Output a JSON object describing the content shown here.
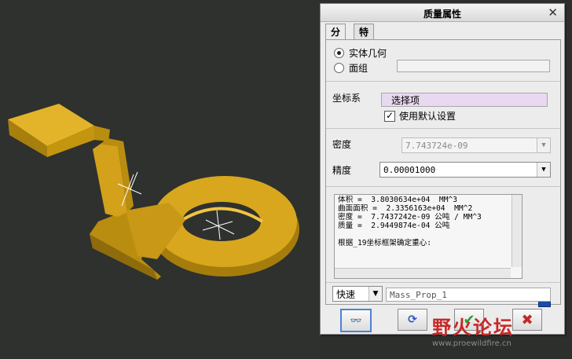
{
  "dialog": {
    "title": "质量属性",
    "tabs": [
      "分析",
      "特征"
    ],
    "radio_options": [
      "实体几何",
      "面组"
    ],
    "selected_option": "实体几何",
    "coordinate_system_label": "坐标系",
    "select_item": "选择项",
    "use_default_setting": "使用默认设置",
    "use_default_checked": true,
    "density_label": "密度",
    "density_value": "7.743724e-09",
    "precision_label": "精度",
    "precision_value": "0.00001000",
    "results_lines": [
      "体积 =  3.8030634e+04  MM^3",
      "曲面面积 =  2.3356163e+04  MM^2",
      "密度 =  7.7437242e-09 公吨 / MM^3",
      "质量 =  2.9449874e-04 公吨",
      "",
      "根据_19坐标框架确定重心:"
    ],
    "speed_mode": "快速",
    "analysis_name": "Mass_Prop_1"
  },
  "icons": {
    "close": "close-icon",
    "info": "info-icon",
    "preview": "glasses-icon",
    "repeat": "refresh-icon",
    "ok": "checkmark-icon",
    "cancel": "cancel-icon"
  },
  "watermark": {
    "title": "野火论坛",
    "url": "www.proewildfire.cn"
  },
  "colors": {
    "model": "#d3a11a",
    "viewport": "#2e312d",
    "select_highlight": "#e8d8f0",
    "ok_green": "#2e9b2e",
    "cancel_red": "#c42727",
    "watermark": "#c62828"
  }
}
